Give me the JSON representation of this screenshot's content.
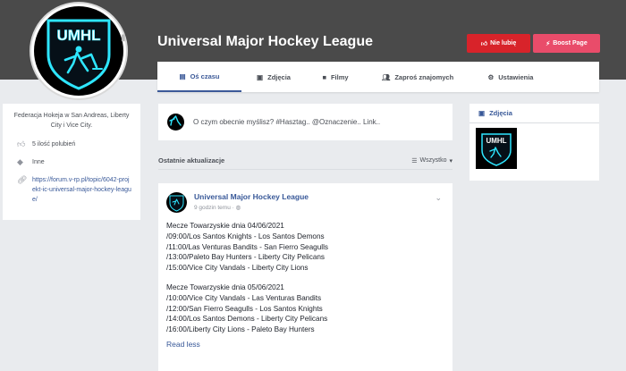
{
  "page": {
    "title": "Universal Major Hockey League",
    "logo_text": "UMHL",
    "colors": {
      "cover": "#4a4a4a",
      "accent": "#3b5998",
      "unlike": "#d8232a",
      "boost": "#e94c6a",
      "logo_glow": "#2ee6ff"
    }
  },
  "header": {
    "unlike_label": "Nie lubię",
    "boost_label": "Boost Page",
    "camera_icon": "camera-icon"
  },
  "nav": {
    "tabs": [
      {
        "label": "Oś czasu",
        "icon": "timeline-icon",
        "active": true
      },
      {
        "label": "Zdjęcia",
        "icon": "photos-icon"
      },
      {
        "label": "Filmy",
        "icon": "video-icon"
      },
      {
        "label": "Zaproś znajomych",
        "icon": "invite-icon"
      },
      {
        "label": "Ustawienia",
        "icon": "settings-icon"
      }
    ]
  },
  "about": {
    "description": "Federacja Hokeja w San Andreas, Liberty City i Vice City.",
    "likes": "5 ilość polubień",
    "category": "Inne",
    "link": "https://forum.v-rp.pl/topic/6042-projekt-ic-universal-major-hockey-league/"
  },
  "composer": {
    "placeholder": "O czym obecnie myślisz? #Hasztag.. @Oznaczenie.. Link.."
  },
  "feed": {
    "recent_title": "Ostatnie aktualizacje",
    "filter_label": "Wszystko"
  },
  "post": {
    "author": "Universal Major Hockey League",
    "time": "9 godzin temu · ",
    "lines_1": [
      "Mecze Towarzyskie dnia 04/06/2021",
      "/09:00/Los Santos Knights - Los Santos Demons",
      "/11:00/Las Venturas Bandits - San Fierro Seagulls",
      "/13:00/Paleto Bay Hunters - Liberty City Pelicans",
      "/15:00/Vice City Vandals - Liberty City Lions"
    ],
    "lines_2": [
      "Mecze Towarzyskie dnia 05/06/2021",
      "/10:00/Vice City Vandals - Las Venturas Bandits",
      "/12:00/San Fierro Seagulls - Los Santos Knights",
      "/14:00/Los Santos Demons - Liberty City Pelicans",
      "/16:00/Liberty City Lions - Paleto Bay Hunters"
    ],
    "read_less": "Read less"
  },
  "sidebar_right": {
    "photos_title": "Zdjęcia"
  }
}
